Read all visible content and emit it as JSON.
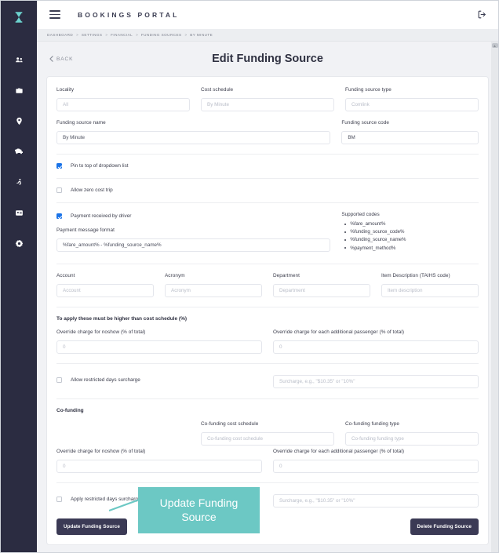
{
  "brand": {
    "logo_icon": "hourglass-logo-icon",
    "accent_color": "#6cc8c4",
    "sidebar_color": "#2b2c41",
    "button_color": "#3b3a55",
    "checkbox_checked_color": "#1a73e8"
  },
  "sidebar": {
    "items": [
      {
        "name": "users-icon",
        "label": "Users"
      },
      {
        "name": "briefcase-icon",
        "label": "Bookings"
      },
      {
        "name": "location-pin-icon",
        "label": "Locations"
      },
      {
        "name": "car-icon",
        "label": "Vehicles"
      },
      {
        "name": "runner-icon",
        "label": "Drivers"
      },
      {
        "name": "id-card-icon",
        "label": "Accounts"
      },
      {
        "name": "gear-icon",
        "label": "Settings"
      }
    ]
  },
  "header": {
    "menu_icon": "hamburger-icon",
    "title": "BOOKINGS PORTAL",
    "logout_icon": "logout-icon"
  },
  "breadcrumb": {
    "separator": ">",
    "items": [
      "DASHBOARD",
      "SETTINGS",
      "FINANCIAL",
      "FUNDING SOURCES",
      "BY MINUTE"
    ]
  },
  "page": {
    "back_label": "BACK",
    "back_icon": "chevron-left-icon",
    "title": "Edit Funding Source"
  },
  "form": {
    "locality": {
      "label": "Locality",
      "value": "All",
      "placeholder": "All"
    },
    "cost_schedule": {
      "label": "Cost schedule",
      "value": "By Minute",
      "placeholder": "By Minute"
    },
    "funding_source_type": {
      "label": "Funding source type",
      "value": "Comlink",
      "placeholder": "Comlink"
    },
    "funding_source_name": {
      "label": "Funding source name",
      "value": "By Minute",
      "placeholder": "Funding source name"
    },
    "funding_source_code": {
      "label": "Funding source code",
      "value": "BM",
      "placeholder": "Funding source code"
    },
    "pin_to_top": {
      "label": "Pin to top of dropdown list",
      "checked": true
    },
    "allow_zero_cost": {
      "label": "Allow zero cost trip",
      "checked": false
    },
    "payment_received_by_driver": {
      "label": "Payment received by driver",
      "checked": true
    },
    "payment_message_format": {
      "label": "Payment message format",
      "value": "%fare_amount% - %funding_source_name%",
      "placeholder": "Payment message format"
    },
    "supported_codes": {
      "title": "Supported codes",
      "items": [
        "%fare_amount%",
        "%funding_source_code%",
        "%funding_source_name%",
        "%payment_method%"
      ]
    },
    "account": {
      "label": "Account",
      "value": "",
      "placeholder": "Account"
    },
    "acronym": {
      "label": "Acronym",
      "value": "",
      "placeholder": "Acronym"
    },
    "department": {
      "label": "Department",
      "value": "",
      "placeholder": "Department"
    },
    "item_description": {
      "label": "Item Description (TAIHS code)",
      "value": "",
      "placeholder": "Item description"
    },
    "apply_note": "To apply these must be higher than cost schedule (%)",
    "override_noshow": {
      "label": "Override charge for noshow (% of total)",
      "value": "0",
      "placeholder": "0"
    },
    "override_additional": {
      "label": "Override charge for each additional passenger (% of total)",
      "value": "0",
      "placeholder": "0"
    },
    "allow_restricted_days": {
      "label": "Allow restricted days surcharge",
      "checked": false
    },
    "surcharge_1": {
      "value": "",
      "placeholder": "Surcharge, e.g., \"$10.35\" or \"10%\""
    },
    "cofunding_title": "Co-funding",
    "cofunding_cost_schedule": {
      "label": "Co-funding cost schedule",
      "value": "",
      "placeholder": "Co-funding cost schedule"
    },
    "cofunding_funding_type": {
      "label": "Co-funding funding type",
      "value": "",
      "placeholder": "Co-funding funding type"
    },
    "cofunding_override_noshow": {
      "label": "Override charge for noshow (% of total)",
      "value": "0",
      "placeholder": "0"
    },
    "cofunding_override_additional": {
      "label": "Override charge for each additional passenger (% of total)",
      "value": "0",
      "placeholder": "0"
    },
    "apply_restricted_days": {
      "label": "Apply restricted days surcharge",
      "checked": false
    },
    "surcharge_2": {
      "value": "",
      "placeholder": "Surcharge, e.g., \"$10.35\" or \"10%\""
    }
  },
  "actions": {
    "update_label": "Update Funding Source",
    "delete_label": "Delete Funding Source"
  },
  "annotation": {
    "callout_text": "Update Funding Source"
  }
}
